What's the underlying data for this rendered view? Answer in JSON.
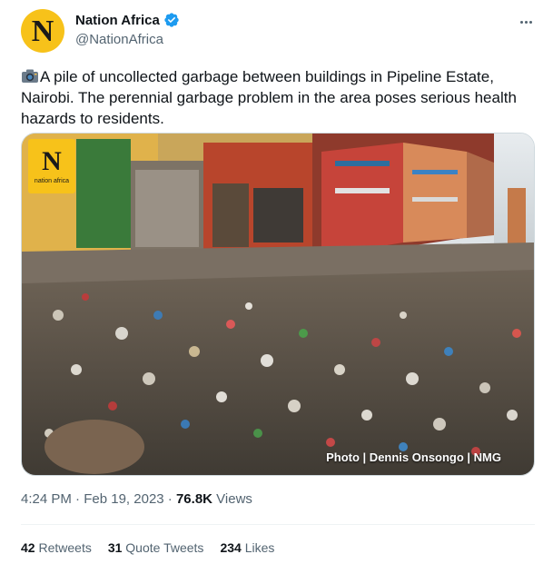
{
  "author": {
    "name": "Nation Africa",
    "handle": "@NationAfrica",
    "avatar_letter": "N",
    "verified": true
  },
  "tweet": {
    "text": "A pile of uncollected garbage between buildings in Pipeline Estate, Nairobi. The perennial garbage problem in the area poses serious health hazards to residents."
  },
  "media": {
    "logo_letter": "N",
    "logo_text": "nation africa",
    "caption": "Photo | Dennis Onsongo | NMG"
  },
  "meta": {
    "time": "4:24 PM",
    "separator": "·",
    "date": "Feb 19, 2023",
    "views_count": "76.8K",
    "views_label": "Views"
  },
  "stats": {
    "retweets_count": "42",
    "retweets_label": "Retweets",
    "quotes_count": "31",
    "quotes_label": "Quote Tweets",
    "likes_count": "234",
    "likes_label": "Likes"
  },
  "colors": {
    "brand_yellow": "#f7c21a",
    "verified_blue": "#1d9bf0",
    "secondary_text": "#536471"
  },
  "icons": [
    "verified-badge-icon",
    "more-options-icon",
    "camera-icon"
  ]
}
